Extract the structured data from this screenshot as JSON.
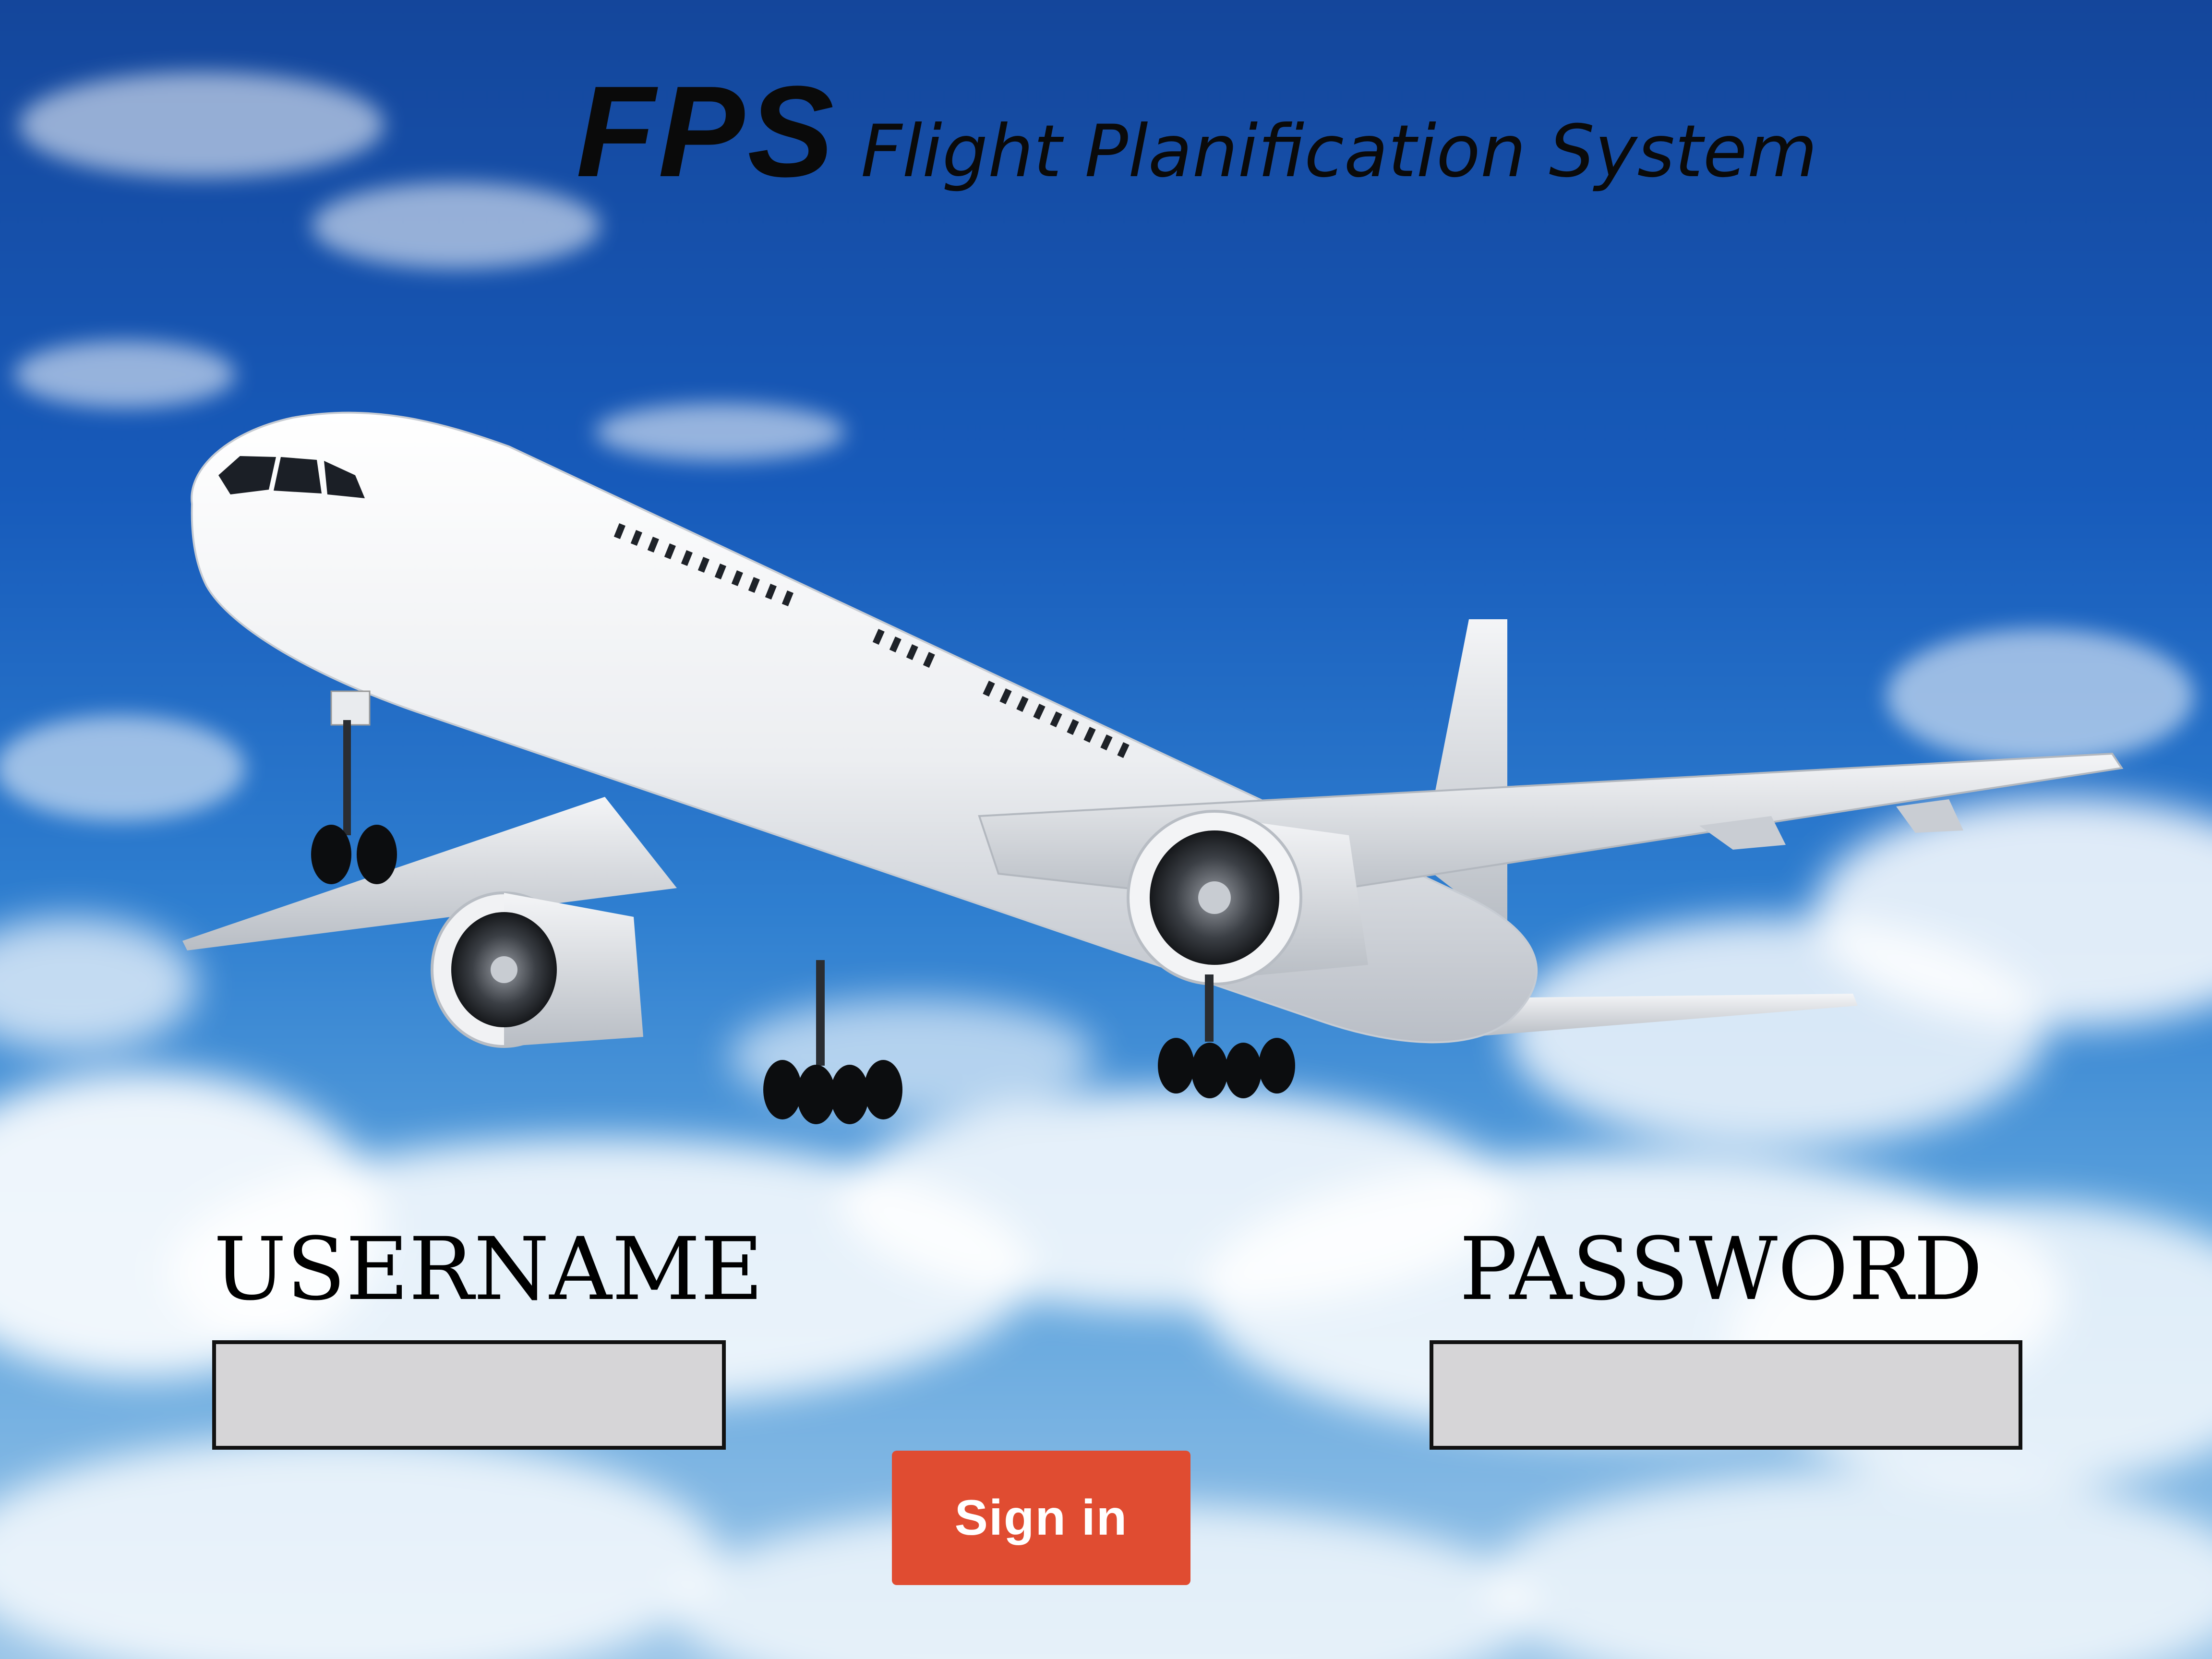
{
  "header": {
    "abbreviation": "FPS",
    "full_name": "Flight Planification System"
  },
  "login_form": {
    "username_label": "USERNAME",
    "username_value": "",
    "password_label": "PASSWORD",
    "password_value": "",
    "signin_label": "Sign in"
  },
  "colors": {
    "sky": "#175bbb",
    "input_background": "#d6d5d7",
    "signin_button": "#e04c31",
    "signin_text": "#ffffff",
    "text": "#000000"
  },
  "images": {
    "background": "sky-with-clouds",
    "foreground": "white-passenger-jet-airplane"
  }
}
